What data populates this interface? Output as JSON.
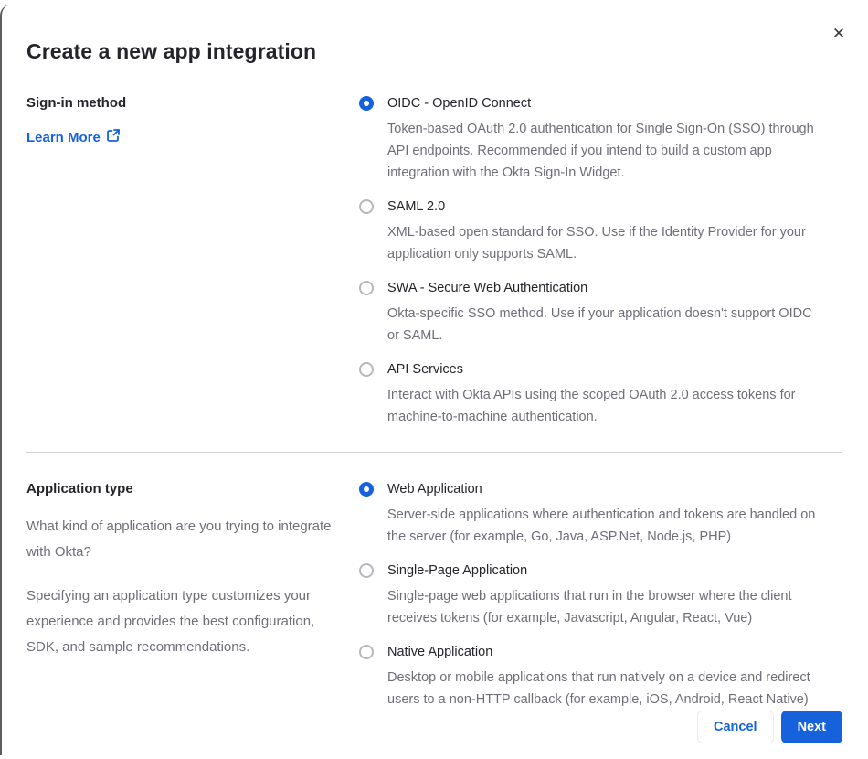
{
  "colors": {
    "accent_blue": "#1662dd",
    "heading_text": "#24242b",
    "body_text": "#6e6e78",
    "divider": "#cfcfd4"
  },
  "icons": {
    "close": "✕",
    "external_link": "external-link"
  },
  "modal": {
    "title": "Create a new app integration"
  },
  "signin_section": {
    "heading": "Sign-in method",
    "learn_more_label": "Learn More",
    "options": [
      {
        "label": "OIDC - OpenID Connect",
        "description": "Token-based OAuth 2.0 authentication for Single Sign-On (SSO) through API endpoints. Recommended if you intend to build a custom app integration with the Okta Sign-In Widget.",
        "selected": true
      },
      {
        "label": "SAML 2.0",
        "description": "XML-based open standard for SSO. Use if the Identity Provider for your application only supports SAML.",
        "selected": false
      },
      {
        "label": "SWA - Secure Web Authentication",
        "description": "Okta-specific SSO method. Use if your application doesn't support OIDC or SAML.",
        "selected": false
      },
      {
        "label": "API Services",
        "description": "Interact with Okta APIs using the scoped OAuth 2.0 access tokens for machine-to-machine authentication.",
        "selected": false
      }
    ]
  },
  "apptype_section": {
    "heading": "Application type",
    "paragraph_1": "What kind of application are you trying to integrate with Okta?",
    "paragraph_2": "Specifying an application type customizes your experience and provides the best configuration, SDK, and sample recommendations.",
    "options": [
      {
        "label": "Web Application",
        "description": "Server-side applications where authentication and tokens are handled on the server (for example, Go, Java, ASP.Net, Node.js, PHP)",
        "selected": true
      },
      {
        "label": "Single-Page Application",
        "description": "Single-page web applications that run in the browser where the client receives tokens (for example, Javascript, Angular, React, Vue)",
        "selected": false
      },
      {
        "label": "Native Application",
        "description": "Desktop or mobile applications that run natively on a device and redirect users to a non-HTTP callback (for example, iOS, Android, React Native)",
        "selected": false
      }
    ]
  },
  "footer": {
    "cancel_label": "Cancel",
    "next_label": "Next"
  }
}
